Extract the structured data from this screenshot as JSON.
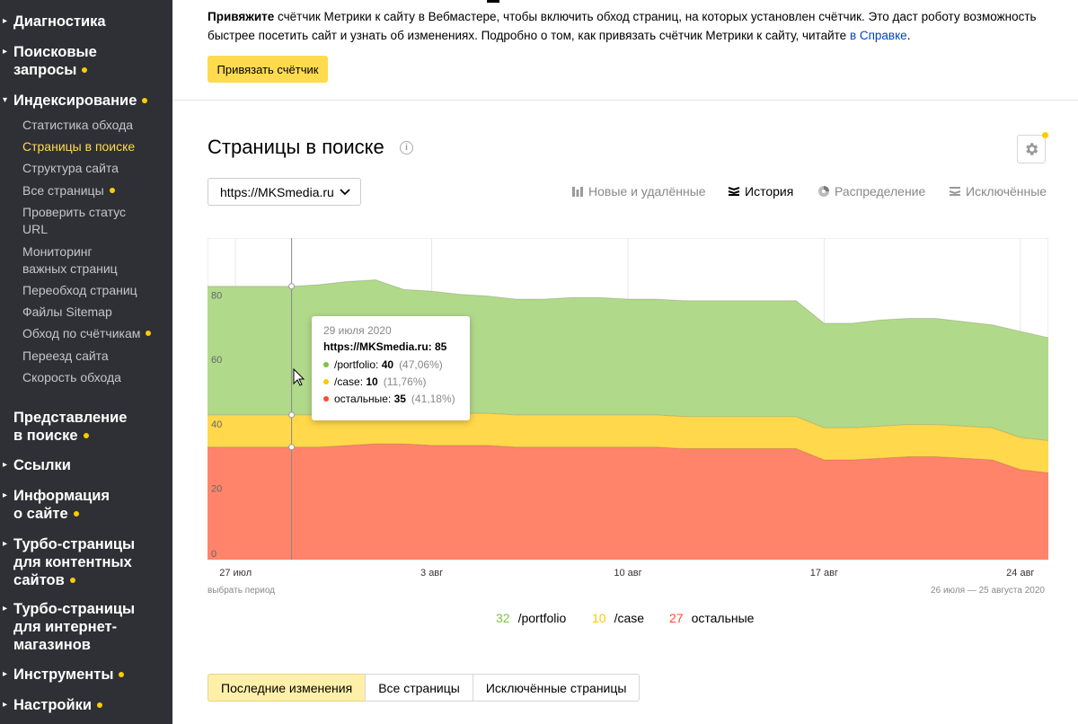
{
  "sidebar": {
    "items": [
      {
        "label": "Диагностика",
        "dot": false
      },
      {
        "label": "Поисковые запросы",
        "dot": true
      },
      {
        "label": "Индексирование",
        "dot": true,
        "expanded": true
      },
      {
        "label": "Представление в поиске",
        "dot": true
      },
      {
        "label": "Ссылки",
        "dot": false
      },
      {
        "label": "Информация о сайте",
        "dot": true
      },
      {
        "label": "Турбо-страницы для контентных сайтов",
        "dot": true
      },
      {
        "label": "Турбо-страницы для интернет-магазинов",
        "dot": false
      },
      {
        "label": "Инструменты",
        "dot": true
      },
      {
        "label": "Настройки",
        "dot": true
      }
    ],
    "indexing_sub": [
      {
        "label": "Статистика обхода"
      },
      {
        "label": "Страницы в поиске",
        "active": true
      },
      {
        "label": "Структура сайта"
      },
      {
        "label": "Все страницы",
        "dot": true
      },
      {
        "label": "Проверить статус URL"
      },
      {
        "label": "Мониторинг важных страниц"
      },
      {
        "label": "Переобход страниц"
      },
      {
        "label": "Файлы Sitemap"
      },
      {
        "label": "Обход по счётчикам",
        "dot": true
      },
      {
        "label": "Переезд сайта"
      },
      {
        "label": "Скорость обхода"
      }
    ]
  },
  "notice": {
    "text_bold": "Привяжите",
    "text": " счётчик Метрики к сайту в Вебмастере, чтобы включить обход страниц, на которых установлен счётчик. Это даст роботу возможность быстрее посетить сайт и узнать об изменениях. Подробно о том, как привязать счётчик Метрики к сайту, читайте ",
    "link": "в Справке",
    "end": ".",
    "button": "Привязать счётчик"
  },
  "page": {
    "title": "Страницы в поиске",
    "site_select": "https://MKSmedia.ru",
    "view_tabs": [
      {
        "label": "Новые и удалённые",
        "icon": "bars-icon",
        "active": false
      },
      {
        "label": "История",
        "icon": "layers-icon",
        "active": true
      },
      {
        "label": "Распределение",
        "icon": "pie-icon",
        "active": false
      },
      {
        "label": "Исключённые",
        "icon": "stack-icon",
        "active": false
      }
    ],
    "period_hint": "выбрать период",
    "period_range": "26 июля — 25 августа 2020",
    "bottom_tabs": [
      "Последние изменения",
      "Все страницы",
      "Исключённые страницы"
    ]
  },
  "tooltip": {
    "date": "29 июля 2020",
    "site": "https://MKSmedia.ru: 85",
    "rows": [
      {
        "name": "/portfolio",
        "value": "40",
        "pct": "(47,06%)"
      },
      {
        "name": "/case",
        "value": "10",
        "pct": "(11,76%)"
      },
      {
        "name": "остальные",
        "value": "35",
        "pct": "(41,18%)"
      }
    ]
  },
  "legend": [
    {
      "num": "32",
      "name": "/portfolio"
    },
    {
      "num": "10",
      "name": "/case"
    },
    {
      "num": "27",
      "name": "остальные"
    }
  ],
  "colors": {
    "portfolio": "#b1d98a",
    "case": "#ffd84b",
    "other": "#ff8469",
    "portfolio_num": "#7fc240",
    "case_num": "#ffc800",
    "other_num": "#ff4a2a"
  },
  "chart_data": {
    "type": "area",
    "stacked": true,
    "x_ticks": [
      "27 июл",
      "3 авг",
      "10 авг",
      "17 авг",
      "24 авг"
    ],
    "x": [
      "26.07",
      "27.07",
      "28.07",
      "29.07",
      "30.07",
      "31.07",
      "01.08",
      "02.08",
      "03.08",
      "04.08",
      "05.08",
      "06.08",
      "07.08",
      "08.08",
      "09.08",
      "10.08",
      "11.08",
      "12.08",
      "13.08",
      "14.08",
      "15.08",
      "16.08",
      "17.08",
      "18.08",
      "19.08",
      "20.08",
      "21.08",
      "22.08",
      "23.08",
      "24.08",
      "25.08"
    ],
    "series": [
      {
        "name": "остальные",
        "values": [
          35,
          35,
          35,
          35,
          35,
          35.5,
          36,
          36,
          35.5,
          35.5,
          35.5,
          35,
          35,
          35,
          35,
          35,
          35,
          34.5,
          34.5,
          34.5,
          34.5,
          34.5,
          31,
          31,
          31.5,
          32,
          32,
          31.5,
          31,
          28,
          27
        ]
      },
      {
        "name": "/case",
        "values": [
          10,
          10,
          10,
          10,
          10,
          10,
          10,
          10,
          10,
          10,
          10,
          10,
          10,
          10,
          10,
          10,
          10,
          10,
          10,
          10,
          10,
          10,
          10,
          10,
          10,
          10,
          10,
          10,
          10,
          10,
          10
        ]
      },
      {
        "name": "/portfolio",
        "values": [
          40,
          40,
          40,
          40,
          40.5,
          41,
          41,
          38,
          38,
          37,
          36.5,
          36,
          36,
          36.5,
          36.5,
          36,
          36,
          36,
          36,
          36,
          36,
          36,
          32.5,
          32.5,
          33,
          33,
          33,
          32.5,
          32,
          33,
          32
        ]
      }
    ],
    "ylim": [
      0,
      100
    ],
    "y_ticks": [
      0,
      20,
      40,
      60,
      80
    ]
  }
}
